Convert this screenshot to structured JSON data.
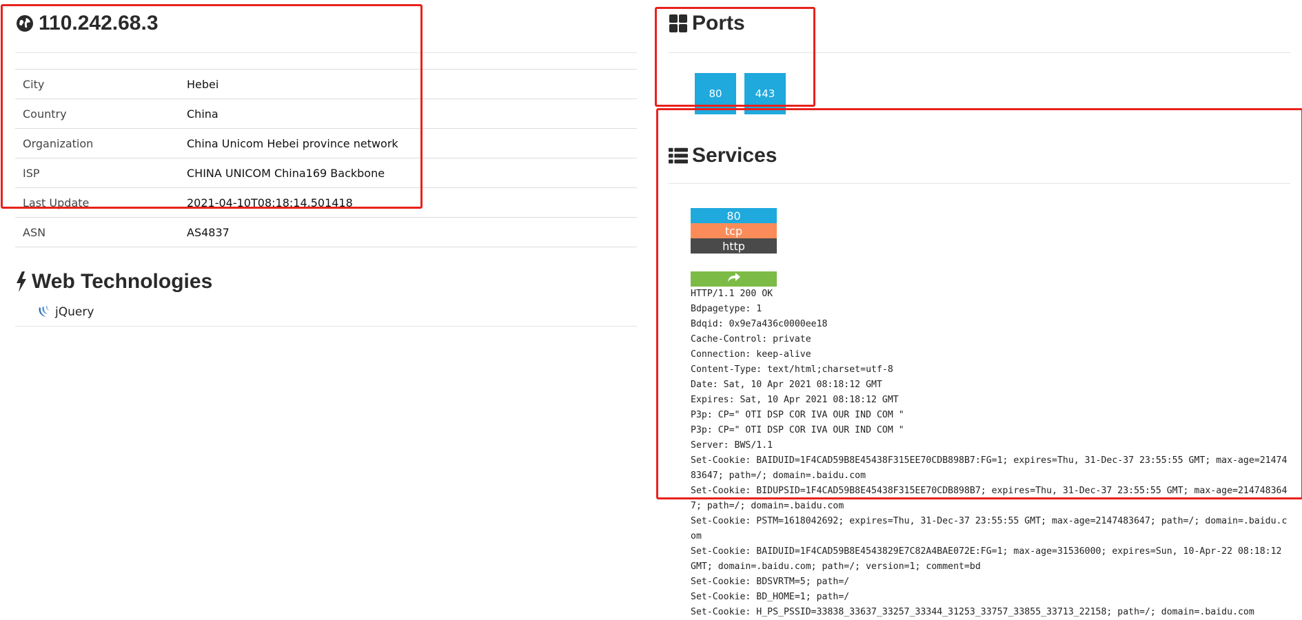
{
  "host": {
    "ip": "110.242.68.3",
    "rows": [
      {
        "key": "City",
        "value": "Hebei"
      },
      {
        "key": "Country",
        "value": "China"
      },
      {
        "key": "Organization",
        "value": "China Unicom Hebei province network"
      },
      {
        "key": "ISP",
        "value": "CHINA UNICOM China169 Backbone"
      },
      {
        "key": "Last Update",
        "value": "2021-04-10T08:18:14.501418"
      },
      {
        "key": "ASN",
        "value": "AS4837"
      }
    ]
  },
  "web_tech": {
    "title": "Web Technologies",
    "items": [
      {
        "name": "jQuery",
        "icon": "jquery-icon"
      }
    ]
  },
  "ports": {
    "title": "Ports",
    "list": [
      "80",
      "443"
    ]
  },
  "services": {
    "title": "Services",
    "entry": {
      "port": "80",
      "protocol": "tcp",
      "service": "http",
      "share_icon": "share-icon",
      "banner": "HTTP/1.1 200 OK\nBdpagetype: 1\nBdqid: 0x9e7a436c0000ee18\nCache-Control: private\nConnection: keep-alive\nContent-Type: text/html;charset=utf-8\nDate: Sat, 10 Apr 2021 08:18:12 GMT\nExpires: Sat, 10 Apr 2021 08:18:12 GMT\nP3p: CP=\" OTI DSP COR IVA OUR IND COM \"\nP3p: CP=\" OTI DSP COR IVA OUR IND COM \"\nServer: BWS/1.1\nSet-Cookie: BAIDUID=1F4CAD59B8E45438F315EE70CDB898B7:FG=1; expires=Thu, 31-Dec-37 23:55:55 GMT; max-age=2147483647; path=/; domain=.baidu.com\nSet-Cookie: BIDUPSID=1F4CAD59B8E45438F315EE70CDB898B7; expires=Thu, 31-Dec-37 23:55:55 GMT; max-age=2147483647; path=/; domain=.baidu.com\nSet-Cookie: PSTM=1618042692; expires=Thu, 31-Dec-37 23:55:55 GMT; max-age=2147483647; path=/; domain=.baidu.com\nSet-Cookie: BAIDUID=1F4CAD59B8E4543829E7C82A4BAE072E:FG=1; max-age=31536000; expires=Sun, 10-Apr-22 08:18:12 GMT; domain=.baidu.com; path=/; version=1; comment=bd\nSet-Cookie: BDSVRTM=5; path=/\nSet-Cookie: BD_HOME=1; path=/\nSet-Cookie: H_PS_PSSID=33838_33637_33257_33344_31253_33757_33855_33713_22158; path=/; domain=.baidu.com"
    }
  },
  "colors": {
    "port_tag": "#1fa9dd",
    "protocol_tag": "#fb8c59",
    "service_tag": "#4a4a4a",
    "share_bar": "#7dbb47",
    "annotation_box": "#e8211b"
  }
}
